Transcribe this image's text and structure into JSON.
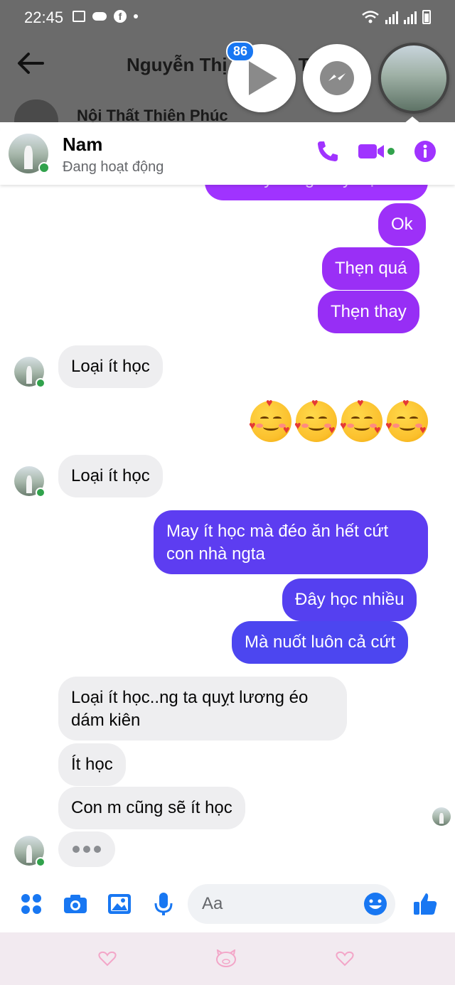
{
  "status_bar": {
    "time": "22:45"
  },
  "background_app": {
    "title": "Nguyễn Thị",
    "title_suffix": "T",
    "sub_name": "Nội Thất Thiên Phúc"
  },
  "chat_heads": {
    "badge_count": "86"
  },
  "chat": {
    "contact_name": "Nam",
    "contact_status": "Đang hoạt động",
    "cut_off_message": "Lên cty cũng thay thịt",
    "messages": {
      "out_ok": "Ok",
      "out_then_qua": "Thẹn quá",
      "out_then_thay": "Thẹn thay",
      "in_loai_1": "Loại ít học",
      "in_loai_2": "Loại ít học",
      "out_may_line1": "May ít học mà đéo ăn hết cứt",
      "out_may_line2": "con nhà ngta",
      "out_day_hoc": "Đây học nhiều",
      "out_ma_nuot": "Mà nuốt luôn cả cứt",
      "in_quyt_line1": "Loại ít học..ng ta quỵt lương éo",
      "in_quyt_line2": "dám kiên",
      "in_it_hoc": "Ít học",
      "in_con_m": "Con m cũng sẽ ít học"
    },
    "emoji_reaction": "smiling-face-with-hearts",
    "emoji_count": 4
  },
  "composer": {
    "placeholder": "Aa"
  },
  "colors": {
    "bubble_purple": "#9b2df6",
    "bubble_indigo": "#5b3df0",
    "bubble_blue": "#4a4bf0",
    "accent": "#a033ff",
    "messenger_blue": "#1877f2",
    "online_green": "#31a24c"
  }
}
